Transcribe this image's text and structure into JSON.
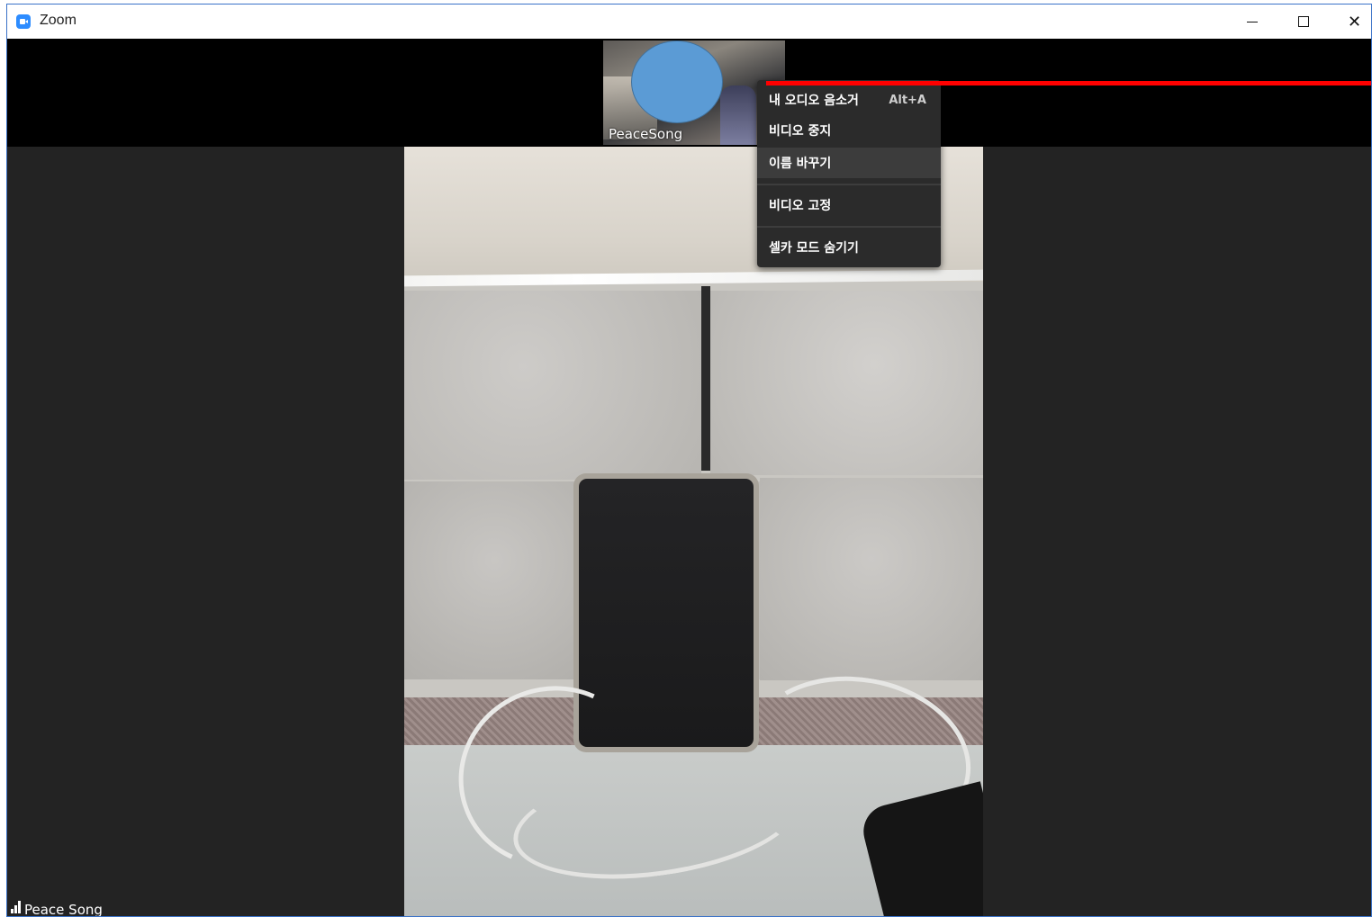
{
  "window": {
    "title": "Zoom",
    "controls": {
      "minimize": "minimize-icon",
      "maximize": "maximize-icon",
      "close": "close-icon"
    }
  },
  "thumbnail": {
    "name": "PeaceSong"
  },
  "context_menu": {
    "items": [
      {
        "label": "내 오디오 음소거",
        "shortcut": "Alt+A"
      },
      {
        "label": "비디오 중지"
      },
      {
        "label": "이름 바꾸기",
        "highlighted": true
      },
      {
        "label": "비디오 고정"
      },
      {
        "label": "셀카 모드 숨기기"
      }
    ]
  },
  "active_speaker": {
    "name": "Peace Song",
    "signal_icon": "signal-bars-icon"
  },
  "colors": {
    "accent": "#2d8cff",
    "annotation": "#ff0000",
    "avatar_overlay": "#5b9bd5",
    "menu_bg": "#2b2b2b"
  }
}
